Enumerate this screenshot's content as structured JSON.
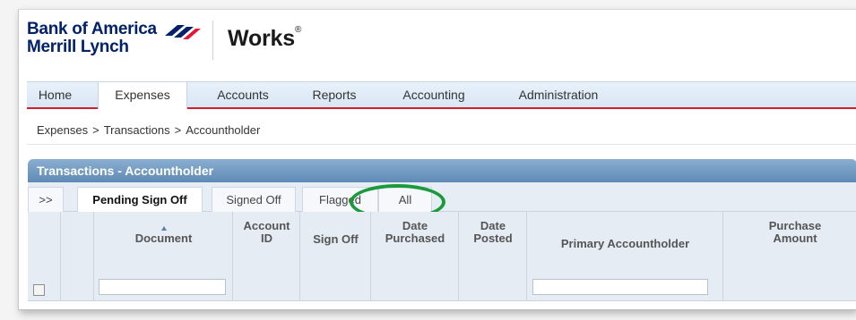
{
  "logo": {
    "brand_line1": "Bank of America",
    "brand_line2": "Merrill Lynch",
    "product": "Works",
    "trademark": "®"
  },
  "nav": {
    "items": [
      {
        "label": "Home"
      },
      {
        "label": "Expenses",
        "active": true
      },
      {
        "label": "Accounts"
      },
      {
        "label": "Reports"
      },
      {
        "label": "Accounting"
      },
      {
        "label": "Administration"
      }
    ]
  },
  "breadcrumb": {
    "items": [
      "Expenses",
      "Transactions",
      "Accountholder"
    ],
    "separator": ">"
  },
  "panel": {
    "title": "Transactions - Accountholder"
  },
  "subtabs": {
    "expand": ">>",
    "items": [
      {
        "label": "Pending Sign Off",
        "active": true
      },
      {
        "label": "Signed Off"
      },
      {
        "label": "Flagged"
      },
      {
        "label": "All"
      }
    ]
  },
  "grid": {
    "columns": {
      "document": "Document",
      "account_id": "Account ID",
      "sign_off": "Sign Off",
      "date_purchased": "Date Purchased",
      "date_posted": "Date Posted",
      "primary_accountholder": "Primary Accountholder",
      "purchase_amount": "Purchase Amount"
    }
  },
  "colors": {
    "brand_navy": "#012169",
    "brand_red": "#d01f2b",
    "panel_blue": "#6f97c2",
    "highlight_green": "#1a9a3a"
  }
}
